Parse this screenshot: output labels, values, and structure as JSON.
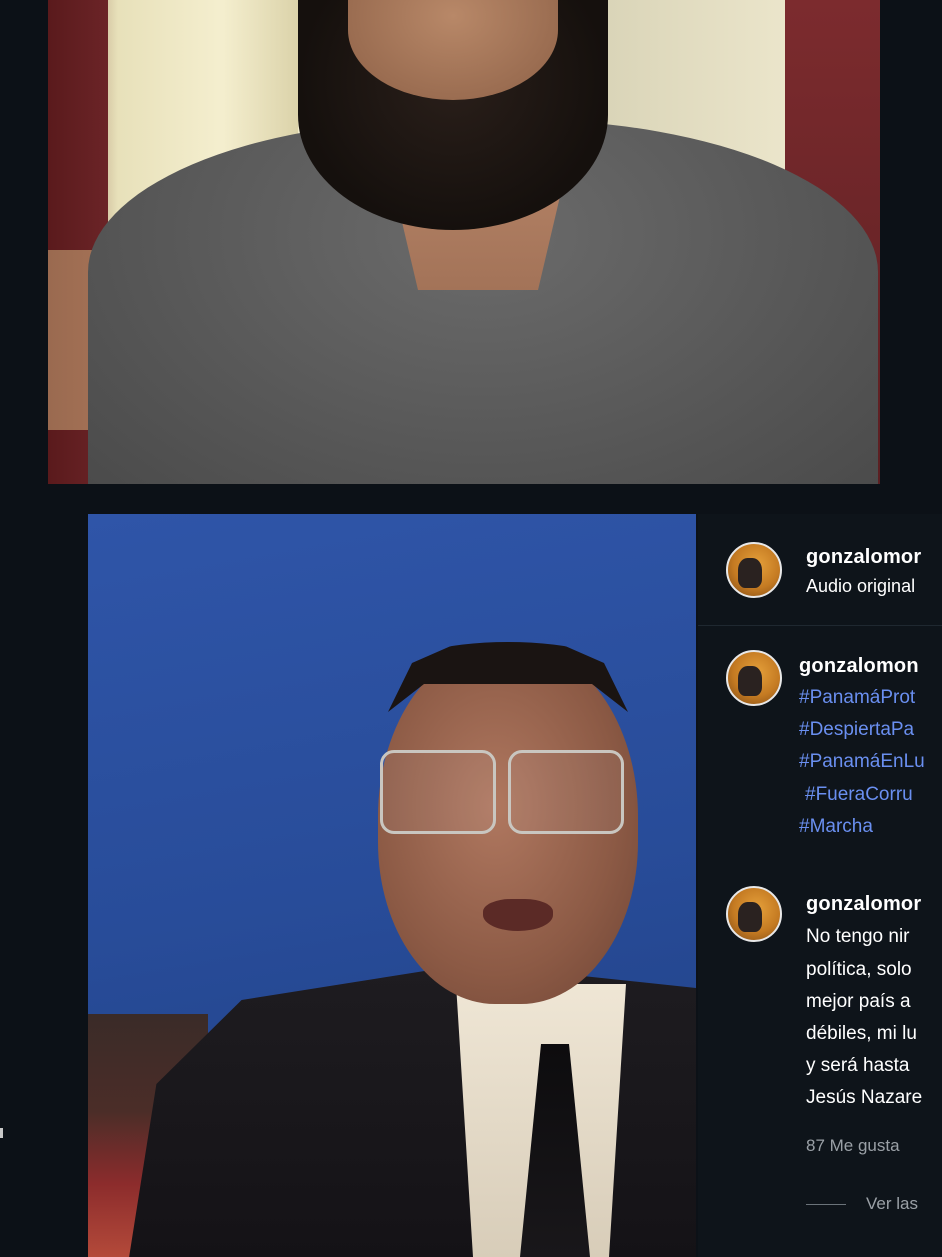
{
  "post": {
    "header_user": "gonzalomor",
    "header_audio": "Audio original",
    "caption_user": "gonzalomon",
    "hashtags": [
      "#PanamáProt",
      "#DespiertaPa",
      "#PanamáEnLu",
      "#FueraCorru",
      "#Marcha"
    ],
    "comment_user": "gonzalomor",
    "comment_lines": [
      "No tengo nir",
      "política, solo",
      "mejor país a",
      "débiles, mi lu",
      "y será hasta",
      "Jesús Nazare"
    ],
    "likes": "87 Me gusta",
    "view_replies": "Ver las"
  },
  "colors": {
    "background": "#0c1117",
    "hashtag": "#6a8ff0",
    "muted_text": "#9aa0a6"
  }
}
